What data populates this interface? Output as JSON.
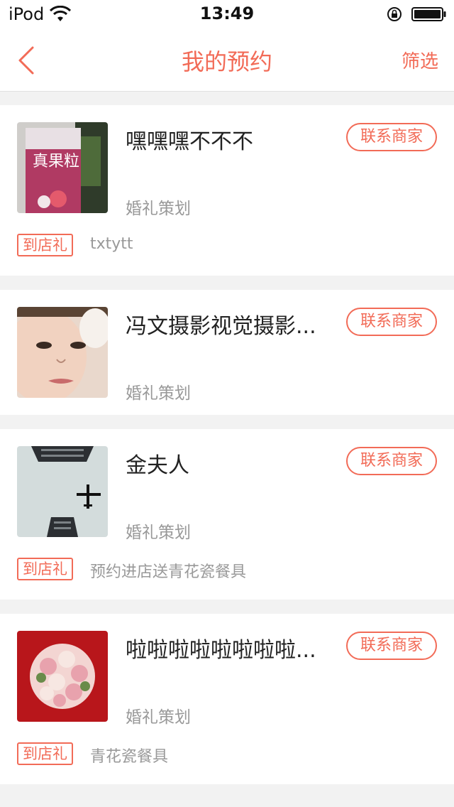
{
  "status_bar": {
    "carrier": "iPod",
    "time": "13:49"
  },
  "nav": {
    "title": "我的预约",
    "filter_label": "筛选"
  },
  "cards": [
    {
      "title": "嘿嘿嘿不不不",
      "category": "婚礼策划",
      "contact_label": "联系商家",
      "gift_label": "到店礼",
      "gift_text": "txtytt"
    },
    {
      "title": "冯文摄影视觉摄影...",
      "category": "婚礼策划",
      "contact_label": "联系商家"
    },
    {
      "title": "金夫人",
      "category": "婚礼策划",
      "contact_label": "联系商家",
      "gift_label": "到店礼",
      "gift_text": "预约进店送青花瓷餐具"
    },
    {
      "title": "啦啦啦啦啦啦啦啦...",
      "category": "婚礼策划",
      "contact_label": "联系商家",
      "gift_label": "到店礼",
      "gift_text": "青花瓷餐具"
    }
  ]
}
